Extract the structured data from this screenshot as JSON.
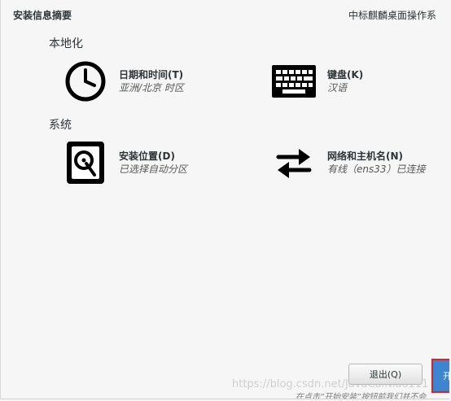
{
  "header": {
    "title": "安装信息摘要",
    "product": "中标麒麟桌面操作系"
  },
  "sections": {
    "localization": {
      "title": "本地化",
      "datetime": {
        "name": "日期和时间(T)",
        "status": "亚洲/北京 时区",
        "icon": "clock-icon"
      },
      "keyboard": {
        "name": "键盘(K)",
        "status": "汉语",
        "icon": "keyboard-icon"
      }
    },
    "system": {
      "title": "系统",
      "destination": {
        "name": "安装位置(D)",
        "status": "已选择自动分区",
        "icon": "hard-disk-icon"
      },
      "network": {
        "name": "网络和主机名(N)",
        "status": "有线（ens33）已连接",
        "icon": "network-arrows-icon"
      }
    }
  },
  "footer": {
    "quit_label": "退出(Q)",
    "begin_label": "开始安装(B)",
    "hint": "在点击“开始安装”按钮前我们并不会",
    "watermark": "https://blog.csdn.net/JavaCaiNiao111"
  },
  "colors": {
    "background": "#f6f6f6",
    "primary_button": "#3d85d0",
    "highlight_border": "#e0201d"
  }
}
